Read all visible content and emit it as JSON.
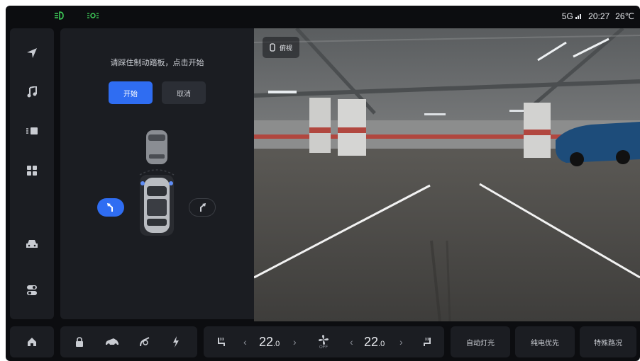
{
  "status_bar": {
    "indicators": [
      "headlight-icon",
      "parking-light-icon"
    ],
    "signal": "5G",
    "time": "20:27",
    "temperature": "26℃"
  },
  "sidebar": {
    "items": [
      "navigation-icon",
      "music-icon",
      "media-icon",
      "apps-icon",
      "car-icon",
      "settings-toggle-icon"
    ]
  },
  "parking": {
    "instruction": "请踩住制动踏板，点击开始",
    "start_label": "开始",
    "cancel_label": "取消",
    "direction_left_selected": true
  },
  "camera": {
    "view_label": "俯视"
  },
  "dock": {
    "home": "home-icon",
    "quick": [
      "lock-icon",
      "car-front-icon",
      "fuel-icon",
      "charging-icon"
    ],
    "climate": {
      "left_temp": "22",
      "left_decimal": ".0",
      "right_temp": "22",
      "right_decimal": ".0",
      "fan_status": "OFF"
    },
    "buttons": [
      "自动灯光",
      "纯电优先",
      "特殊路况"
    ]
  },
  "colors": {
    "accent": "#2f6df2",
    "background": "#0c0d10",
    "panel": "#1b1d22",
    "indicator": "#3fd15a"
  }
}
